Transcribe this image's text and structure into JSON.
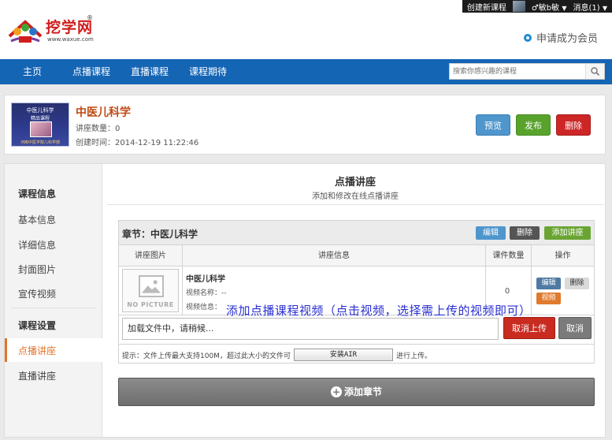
{
  "topbar": {
    "create_course": "创建新课程",
    "username": "♂敏b敏",
    "messages": "消息(1)"
  },
  "header": {
    "logo_text": "挖学网",
    "logo_reg": "®",
    "logo_url": "www.waxue.com",
    "member_link": "申请成为会员"
  },
  "nav": {
    "items": [
      "主页",
      "点播课程",
      "直播课程",
      "课程期待"
    ],
    "search_placeholder": "搜索你感兴趣的课程"
  },
  "course": {
    "thumb_line1": "中医儿科学",
    "thumb_line2": "精品课程",
    "thumb_line3": "河南中医学院儿科学部",
    "title": "中医儿科学",
    "lecture_count": "讲座数量：0",
    "created": "创建时间：2014-12-19 11:22:46",
    "btn_preview": "预览",
    "btn_publish": "发布",
    "btn_delete": "删除"
  },
  "sidebar": {
    "section1": "课程信息",
    "items1": [
      "基本信息",
      "详细信息",
      "封面图片",
      "宣传视频"
    ],
    "section2": "课程设置",
    "active": "点播讲座",
    "items2": [
      "直播讲座"
    ]
  },
  "content": {
    "title": "点播讲座",
    "subtitle": "添加和修改在线点播讲座"
  },
  "chapter": {
    "title": "章节：中医儿科学",
    "btn_edit": "编辑",
    "btn_delete": "删除",
    "btn_add": "添加讲座",
    "columns": [
      "讲座图片",
      "讲座信息",
      "课件数量",
      "操作"
    ],
    "row": {
      "nopic": "NO PICTURE",
      "title": "中医儿科学",
      "video_name": "视频名称：--",
      "video_info": "视频信息：",
      "count": "0",
      "op_edit": "编辑",
      "op_delete": "删除",
      "op_video": "视频"
    },
    "upload_status": "加载文件中，请稍候...",
    "btn_cancel_upload": "取消上传",
    "btn_cancel": "取消",
    "tip_prefix": "提示：文件上传最大支持100M，超过此大小的文件可",
    "tip_button": "安装AIR",
    "tip_suffix": "进行上传。"
  },
  "overlay_text": "添加点播课程视频（点击视频，选择需上传的视频即可）",
  "add_chapter": "添加章节"
}
